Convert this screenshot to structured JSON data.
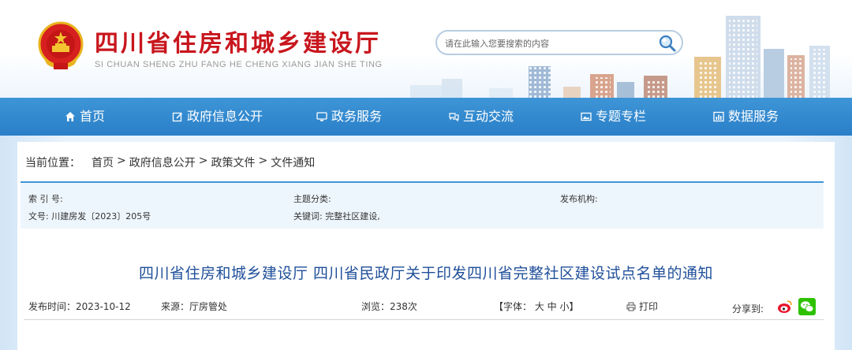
{
  "header": {
    "title": "四川省住房和城乡建设厅",
    "pinyin": "SI CHUAN SHENG ZHU FANG HE CHENG XIANG JIAN SHE TING",
    "search_placeholder": "请在此输入您要搜索的内容"
  },
  "nav": {
    "items": [
      {
        "label": "首页",
        "icon": "home-icon"
      },
      {
        "label": "政府信息公开",
        "icon": "edit-icon"
      },
      {
        "label": "政务服务",
        "icon": "monitor-icon"
      },
      {
        "label": "互动交流",
        "icon": "chat-icon"
      },
      {
        "label": "专题专栏",
        "icon": "image-icon"
      },
      {
        "label": "数据服务",
        "icon": "chart-icon"
      }
    ]
  },
  "breadcrumb": {
    "lead": "当前位置：",
    "items": [
      "首页",
      "政府信息公开",
      "政策文件",
      "文件通知"
    ],
    "separator": ">"
  },
  "meta": {
    "index_label": "索 引 号:",
    "index_value": "",
    "topic_label": "主题分类:",
    "topic_value": "",
    "publisher_label": "发布机构:",
    "publisher_value": "",
    "docno_label": "文号:",
    "docno_value": "川建房发〔2023〕205号",
    "keywords_label": "关键词:",
    "keywords_value": "完整社区建设,"
  },
  "document": {
    "title": "四川省住房和城乡建设厅 四川省民政厅关于印发四川省完整社区建设试点名单的通知",
    "publish_label": "发布时间：",
    "publish_date": "2023-10-12",
    "source_label": "来源：",
    "source_value": "厅房管处",
    "views_label": "浏览：",
    "views_value": "238次",
    "font_size_label": "【字体： 大 中 小】",
    "print_label": "打印",
    "share_label": "分享到:"
  },
  "colors": {
    "title_red": "#c8161d",
    "nav_blue": "#2a7fc8",
    "doc_title_blue": "#1f4f9a",
    "weibo_red": "#e6162d",
    "wechat_green": "#2dc100"
  }
}
